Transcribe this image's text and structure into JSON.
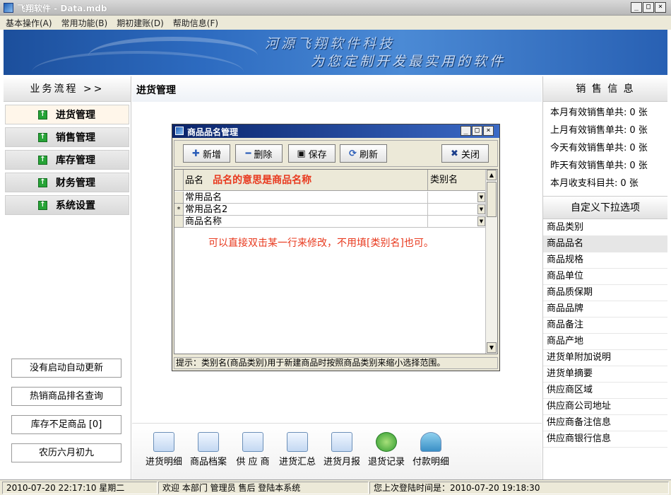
{
  "window": {
    "title": "飞翔软件 - Data.mdb",
    "minimize": "_",
    "maximize": "□",
    "close": "×"
  },
  "menu": [
    "基本操作(A)",
    "常用功能(B)",
    "期初建账(D)",
    "帮助信息(F)"
  ],
  "banner": {
    "line1": "河源飞翔软件科技",
    "line2": "为您定制开发最实用的软件"
  },
  "left_panel": {
    "header": "业务流程 >>",
    "nav": [
      "进货管理",
      "销售管理",
      "库存管理",
      "财务管理",
      "系统设置"
    ],
    "bottom_buttons": [
      "没有启动自动更新",
      "热销商品排名查询",
      "库存不足商品 [0]",
      "农历六月初九"
    ]
  },
  "center": {
    "title": "进货管理",
    "toolbar": [
      "进货明细",
      "商品档案",
      "供 应 商",
      "进货汇总",
      "进货月报",
      "退货记录",
      "付款明细"
    ]
  },
  "dialog": {
    "title": "商品品名管理",
    "buttons": {
      "add": "新增",
      "delete": "删除",
      "save": "保存",
      "refresh": "刷新",
      "close": "关闭"
    },
    "columns": {
      "name": "品名",
      "name_hint": "品名的意思是商品名称",
      "category": "类别名"
    },
    "rows": [
      {
        "indicator": "",
        "name": "常用品名",
        "category": ""
      },
      {
        "indicator": "*",
        "name": "常用品名2",
        "category": ""
      },
      {
        "indicator": "",
        "name": "商品名称",
        "category": ""
      }
    ],
    "grid_note": "可以直接双击某一行来修改，不用填[类别名]也可。",
    "status": "提示：类别名(商品类别)用于新建商品时按照商品类别来缩小选择范围。"
  },
  "right_panel": {
    "sales_header": "销 售 信 息",
    "sales": [
      {
        "label": "本月有效销售单共:",
        "value": "0 张"
      },
      {
        "label": "上月有效销售单共:",
        "value": "0 张"
      },
      {
        "label": "今天有效销售单共:",
        "value": "0 张"
      },
      {
        "label": "昨天有效销售单共:",
        "value": "0 张"
      },
      {
        "label": "本月收支科目共:",
        "value": "0 张"
      }
    ],
    "options_header": "自定义下拉选项",
    "options": [
      "商品类别",
      "商品品名",
      "商品规格",
      "商品单位",
      "商品质保期",
      "商品品牌",
      "商品备注",
      "商品产地",
      "进货单附加说明",
      "进货单摘要",
      "供应商区域",
      "供应商公司地址",
      "供应商备注信息",
      "供应商银行信息"
    ],
    "selected_option": "商品品名"
  },
  "status_bar": {
    "datetime": "2010-07-20 22:17:10 星期二",
    "welcome": "欢迎 本部门 管理员 售后 登陆本系统",
    "last_login": "您上次登陆时间是：2010-07-20 19:18:30"
  },
  "colors": {
    "hint_red": "#e8391e",
    "dialog_title_blue": "#0a246a",
    "nav_icon_green": "#26a336"
  }
}
